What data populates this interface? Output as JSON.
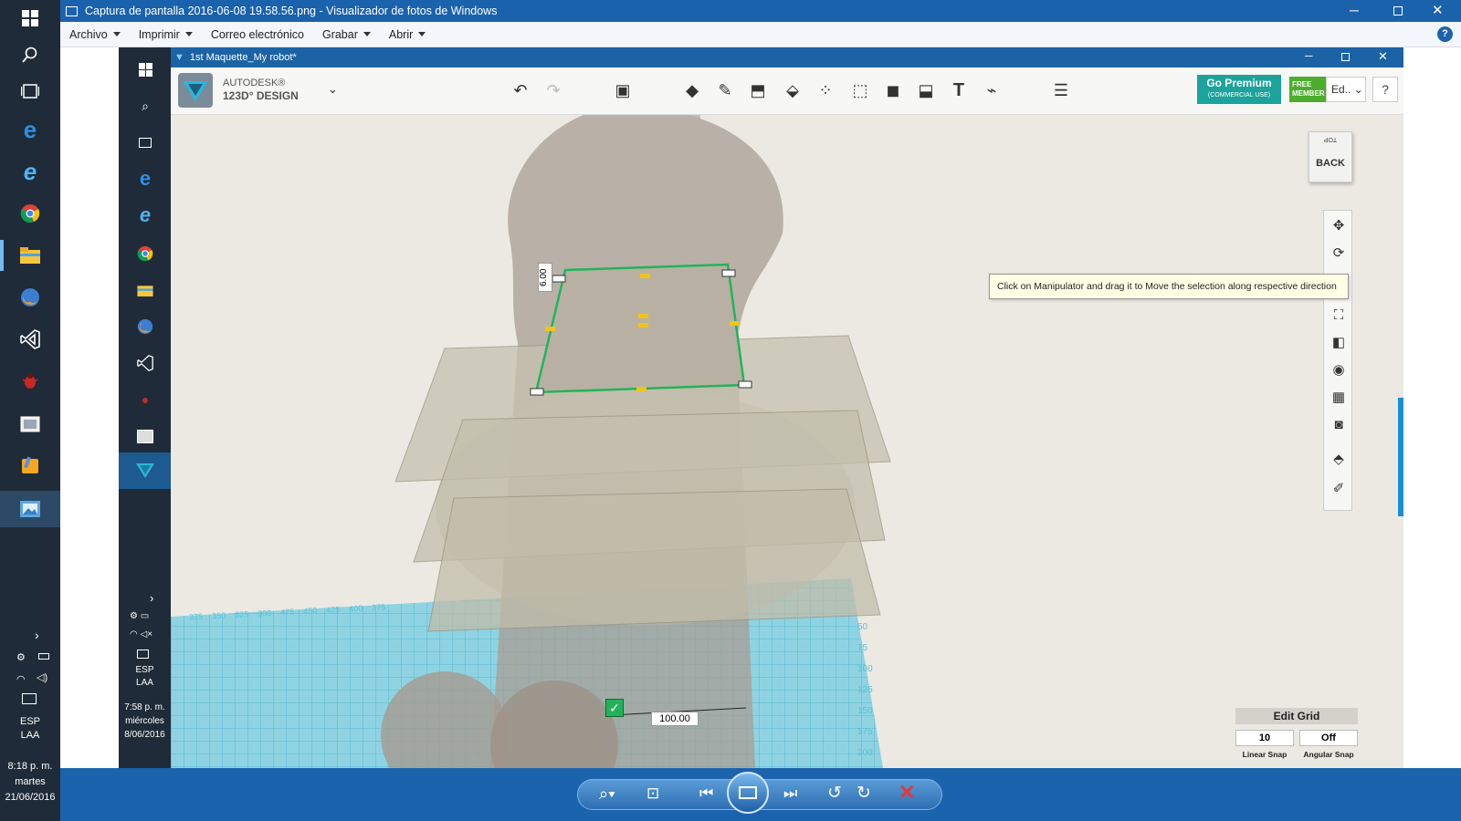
{
  "window": {
    "title": "Captura de pantalla 2016-06-08 19.58.56.png - Visualizador de fotos de Windows"
  },
  "menu": [
    {
      "label": "Archivo"
    },
    {
      "label": "Imprimir"
    },
    {
      "label": "Correo electrónico"
    },
    {
      "label": "Grabar"
    },
    {
      "label": "Abrir"
    }
  ],
  "outer_taskbar": {
    "lang1": "ESP",
    "lang2": "LAA",
    "time": "8:18 p. m.",
    "day": "martes",
    "date": "21/06/2016"
  },
  "inner_taskbar": {
    "lang1": "ESP",
    "lang2": "LAA",
    "time": "7:58 p. m.",
    "day": "miércoles",
    "date": "8/06/2016"
  },
  "app": {
    "doc_title": "1st Maquette_My robot*",
    "brand_line1": "AUTODESK®",
    "brand_line2": "123D° DESIGN",
    "premium_label": "Go Premium",
    "premium_sub": "(COMMERCIAL USE)",
    "free_label_1": "FREE",
    "free_label_2": "MEMBER",
    "account_label": "Ed..",
    "help_label": "?"
  },
  "viewcube": {
    "top": "TOP",
    "face": "BACK"
  },
  "tooltip": "Click on Manipulator and drag it to Move the selection along respective direction",
  "dimensions": {
    "height": "6.00",
    "width": "100.00"
  },
  "grid_panel": {
    "title": "Edit Grid",
    "linear_value": "10",
    "angular_value": "Off",
    "linear_label": "Linear Snap",
    "angular_label": "Angular Snap"
  },
  "grid_ticks_x": [
    "375",
    "350",
    "325",
    "300",
    "475",
    "450",
    "425",
    "400",
    "375"
  ],
  "grid_ticks_y": [
    "50",
    "75",
    "100",
    "125",
    "150",
    "175",
    "200"
  ],
  "colors": {
    "accent": "#1c63ad",
    "selection": "#22b35a",
    "grid": "#4fc3d9",
    "premium": "#1ba39c"
  }
}
